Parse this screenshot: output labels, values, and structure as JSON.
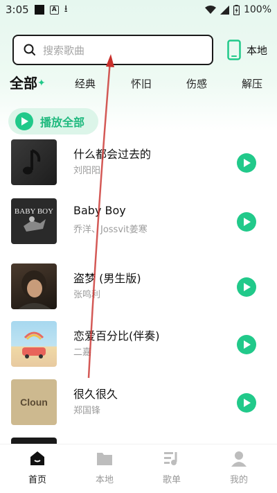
{
  "status_bar": {
    "time": "3:05",
    "battery": "100%"
  },
  "search": {
    "placeholder": "搜索歌曲"
  },
  "local_button": {
    "label": "本地"
  },
  "tabs": [
    {
      "label": "全部",
      "active": true
    },
    {
      "label": "经典"
    },
    {
      "label": "怀旧"
    },
    {
      "label": "伤感"
    },
    {
      "label": "解压"
    }
  ],
  "play_all": {
    "label": "播放全部"
  },
  "songs": [
    {
      "title": "什么都会过去的",
      "artist": "刘阳阳"
    },
    {
      "title": "Baby Boy",
      "artist": "乔洋、Jossvit姜寒",
      "cover_text": "BABY BOY"
    },
    {
      "title": "盗梦 (男生版)",
      "artist": "张鸣利"
    },
    {
      "title": "恋爱百分比(伴奏)",
      "artist": "二嘉"
    },
    {
      "title": "很久很久",
      "artist": "郑国锋",
      "cover_text": "Cloun"
    }
  ],
  "bottom_nav": [
    {
      "label": "首页",
      "icon": "home-icon",
      "active": true
    },
    {
      "label": "本地",
      "icon": "folder-icon"
    },
    {
      "label": "歌单",
      "icon": "playlist-icon"
    },
    {
      "label": "我的",
      "icon": "profile-icon"
    }
  ],
  "colors": {
    "accent": "#21c98a",
    "swipe_arrow": "#c9302c"
  }
}
